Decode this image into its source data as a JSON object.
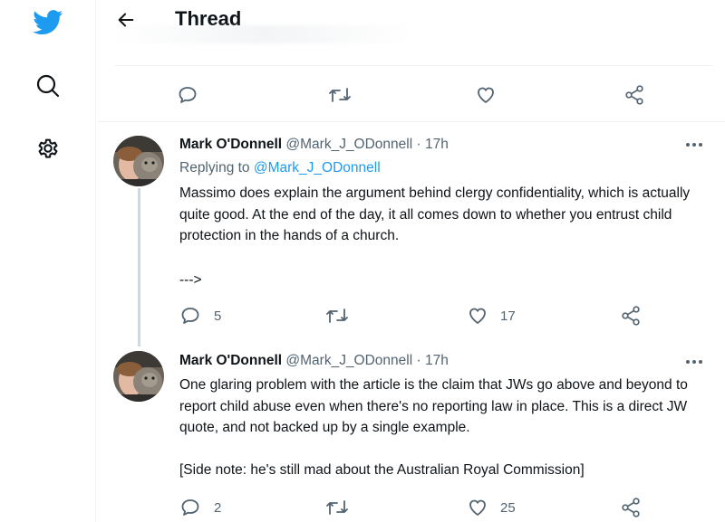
{
  "nav": {
    "logo_icon": "twitter-bird-icon",
    "search_icon": "search-icon",
    "settings_icon": "gear-icon",
    "brand_color": "#1d9bf0"
  },
  "header": {
    "title": "Thread",
    "back_icon": "arrow-left-icon"
  },
  "top_actions": {
    "reply_icon": "reply-icon",
    "retweet_icon": "retweet-icon",
    "like_icon": "heart-icon",
    "share_icon": "share-icon"
  },
  "tweets": [
    {
      "name": "Mark O'Donnell",
      "handle": "@Mark_J_ODonnell",
      "dot": "·",
      "time": "17h",
      "replying_label": "Replying to",
      "replying_to": "@Mark_J_ODonnell",
      "body": [
        "Massimo does explain the argument behind clergy confidentiality, which is actually quite good. At the end of the day, it all comes down to whether you entrust child protection in the hands of a church.",
        "--->"
      ],
      "replies": "5",
      "retweets": "",
      "likes": "17"
    },
    {
      "name": "Mark O'Donnell",
      "handle": "@Mark_J_ODonnell",
      "dot": "·",
      "time": "17h",
      "body": [
        "One glaring problem with the article is the claim that JWs go above and beyond to report child abuse even when there's no reporting law in place. This is a direct JW quote, and not backed up by a single example.",
        "[Side note: he's still mad about the Australian Royal Commission]"
      ],
      "replies": "2",
      "retweets": "",
      "likes": "25"
    }
  ],
  "colors": {
    "text_primary": "#0f1419",
    "text_secondary": "#536471",
    "link": "#1d9bf0",
    "divider": "#eff3f4",
    "thread_line": "#cfd9de"
  }
}
